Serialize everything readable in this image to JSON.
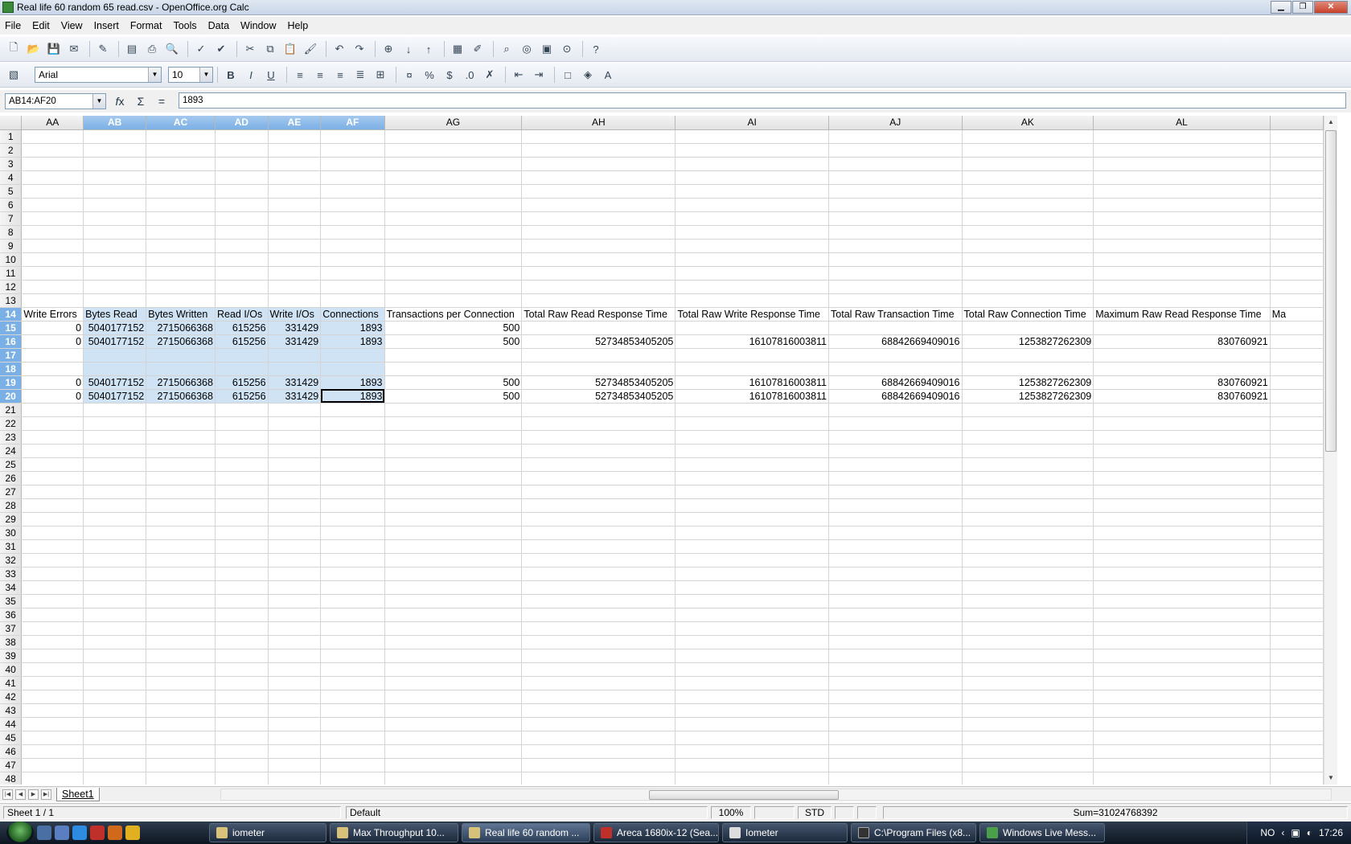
{
  "window": {
    "title": "Real life 60 random 65 read.csv - OpenOffice.org Calc"
  },
  "menu": [
    "File",
    "Edit",
    "View",
    "Insert",
    "Format",
    "Tools",
    "Data",
    "Window",
    "Help"
  ],
  "format_toolbar": {
    "font_name": "Arial",
    "font_size": "10"
  },
  "formula_bar": {
    "name_box": "AB14:AF20",
    "content": "1893"
  },
  "columns": [
    "AA",
    "AB",
    "AC",
    "AD",
    "AE",
    "AF",
    "AG",
    "AH",
    "AI",
    "AJ",
    "AK",
    "AL",
    ""
  ],
  "rows": [
    {
      "n": "1",
      "cells": [
        "",
        "",
        "",
        "",
        "",
        "",
        "",
        "",
        "",
        "",
        "",
        "",
        ""
      ]
    },
    {
      "n": "2",
      "cells": [
        "",
        "",
        "",
        "",
        "",
        "",
        "",
        "",
        "",
        "",
        "",
        "",
        ""
      ]
    },
    {
      "n": "3",
      "cells": [
        "",
        "",
        "",
        "",
        "",
        "",
        "",
        "",
        "",
        "",
        "",
        "",
        ""
      ]
    },
    {
      "n": "4",
      "cells": [
        "",
        "",
        "",
        "",
        "",
        "",
        "",
        "",
        "",
        "",
        "",
        "",
        ""
      ]
    },
    {
      "n": "5",
      "cells": [
        "",
        "",
        "",
        "",
        "",
        "",
        "",
        "",
        "",
        "",
        "",
        "",
        ""
      ]
    },
    {
      "n": "6",
      "cells": [
        "",
        "",
        "",
        "",
        "",
        "",
        "",
        "",
        "",
        "",
        "",
        "",
        ""
      ]
    },
    {
      "n": "7",
      "cells": [
        "",
        "",
        "",
        "",
        "",
        "",
        "",
        "",
        "",
        "",
        "",
        "",
        ""
      ]
    },
    {
      "n": "8",
      "cells": [
        "",
        "",
        "",
        "",
        "",
        "",
        "",
        "",
        "",
        "",
        "",
        "",
        ""
      ]
    },
    {
      "n": "9",
      "cells": [
        "",
        "",
        "",
        "",
        "",
        "",
        "",
        "",
        "",
        "",
        "",
        "",
        ""
      ]
    },
    {
      "n": "10",
      "cells": [
        "",
        "",
        "",
        "",
        "",
        "",
        "",
        "",
        "",
        "",
        "",
        "",
        ""
      ]
    },
    {
      "n": "11",
      "cells": [
        "",
        "",
        "",
        "",
        "",
        "",
        "",
        "",
        "",
        "",
        "",
        "",
        ""
      ]
    },
    {
      "n": "12",
      "cells": [
        "",
        "",
        "",
        "",
        "",
        "",
        "",
        "",
        "",
        "",
        "",
        "",
        ""
      ]
    },
    {
      "n": "13",
      "cells": [
        "",
        "",
        "",
        "",
        "",
        "",
        "",
        "",
        "",
        "",
        "",
        "",
        ""
      ]
    },
    {
      "n": "14",
      "cells": [
        "Write Errors",
        "Bytes Read",
        "Bytes Written",
        "Read I/Os",
        "Write I/Os",
        "Connections",
        "Transactions per Connection",
        "Total Raw Read Response Time",
        "Total Raw Write Response Time",
        "Total Raw Transaction Time",
        "Total Raw Connection Time",
        "Maximum Raw Read Response Time",
        "Ma"
      ]
    },
    {
      "n": "15",
      "cells": [
        "0",
        "5040177152",
        "2715066368",
        "615256",
        "331429",
        "1893",
        "500",
        "",
        "",
        "",
        "",
        "",
        ""
      ]
    },
    {
      "n": "16",
      "cells": [
        "0",
        "5040177152",
        "2715066368",
        "615256",
        "331429",
        "1893",
        "500",
        "52734853405205",
        "16107816003811",
        "68842669409016",
        "1253827262309",
        "830760921",
        ""
      ]
    },
    {
      "n": "17",
      "cells": [
        "",
        "",
        "",
        "",
        "",
        "",
        "",
        "",
        "",
        "",
        "",
        "",
        ""
      ]
    },
    {
      "n": "18",
      "cells": [
        "",
        "",
        "",
        "",
        "",
        "",
        "",
        "",
        "",
        "",
        "",
        "",
        ""
      ]
    },
    {
      "n": "19",
      "cells": [
        "0",
        "5040177152",
        "2715066368",
        "615256",
        "331429",
        "1893",
        "500",
        "52734853405205",
        "16107816003811",
        "68842669409016",
        "1253827262309",
        "830760921",
        ""
      ]
    },
    {
      "n": "20",
      "cells": [
        "0",
        "5040177152",
        "2715066368",
        "615256",
        "331429",
        "1893",
        "500",
        "52734853405205",
        "16107816003811",
        "68842669409016",
        "1253827262309",
        "830760921",
        ""
      ]
    },
    {
      "n": "21",
      "cells": [
        "",
        "",
        "",
        "",
        "",
        "",
        "",
        "",
        "",
        "",
        "",
        "",
        ""
      ]
    },
    {
      "n": "22",
      "cells": [
        "",
        "",
        "",
        "",
        "",
        "",
        "",
        "",
        "",
        "",
        "",
        "",
        ""
      ]
    },
    {
      "n": "23",
      "cells": [
        "",
        "",
        "",
        "",
        "",
        "",
        "",
        "",
        "",
        "",
        "",
        "",
        ""
      ]
    },
    {
      "n": "24",
      "cells": [
        "",
        "",
        "",
        "",
        "",
        "",
        "",
        "",
        "",
        "",
        "",
        "",
        ""
      ]
    },
    {
      "n": "25",
      "cells": [
        "",
        "",
        "",
        "",
        "",
        "",
        "",
        "",
        "",
        "",
        "",
        "",
        ""
      ]
    },
    {
      "n": "26",
      "cells": [
        "",
        "",
        "",
        "",
        "",
        "",
        "",
        "",
        "",
        "",
        "",
        "",
        ""
      ]
    },
    {
      "n": "27",
      "cells": [
        "",
        "",
        "",
        "",
        "",
        "",
        "",
        "",
        "",
        "",
        "",
        "",
        ""
      ]
    },
    {
      "n": "28",
      "cells": [
        "",
        "",
        "",
        "",
        "",
        "",
        "",
        "",
        "",
        "",
        "",
        "",
        ""
      ]
    },
    {
      "n": "29",
      "cells": [
        "",
        "",
        "",
        "",
        "",
        "",
        "",
        "",
        "",
        "",
        "",
        "",
        ""
      ]
    },
    {
      "n": "30",
      "cells": [
        "",
        "",
        "",
        "",
        "",
        "",
        "",
        "",
        "",
        "",
        "",
        "",
        ""
      ]
    },
    {
      "n": "31",
      "cells": [
        "",
        "",
        "",
        "",
        "",
        "",
        "",
        "",
        "",
        "",
        "",
        "",
        ""
      ]
    },
    {
      "n": "32",
      "cells": [
        "",
        "",
        "",
        "",
        "",
        "",
        "",
        "",
        "",
        "",
        "",
        "",
        ""
      ]
    },
    {
      "n": "33",
      "cells": [
        "",
        "",
        "",
        "",
        "",
        "",
        "",
        "",
        "",
        "",
        "",
        "",
        ""
      ]
    },
    {
      "n": "34",
      "cells": [
        "",
        "",
        "",
        "",
        "",
        "",
        "",
        "",
        "",
        "",
        "",
        "",
        ""
      ]
    },
    {
      "n": "35",
      "cells": [
        "",
        "",
        "",
        "",
        "",
        "",
        "",
        "",
        "",
        "",
        "",
        "",
        ""
      ]
    },
    {
      "n": "36",
      "cells": [
        "",
        "",
        "",
        "",
        "",
        "",
        "",
        "",
        "",
        "",
        "",
        "",
        ""
      ]
    },
    {
      "n": "37",
      "cells": [
        "",
        "",
        "",
        "",
        "",
        "",
        "",
        "",
        "",
        "",
        "",
        "",
        ""
      ]
    },
    {
      "n": "38",
      "cells": [
        "",
        "",
        "",
        "",
        "",
        "",
        "",
        "",
        "",
        "",
        "",
        "",
        ""
      ]
    },
    {
      "n": "39",
      "cells": [
        "",
        "",
        "",
        "",
        "",
        "",
        "",
        "",
        "",
        "",
        "",
        "",
        ""
      ]
    },
    {
      "n": "40",
      "cells": [
        "",
        "",
        "",
        "",
        "",
        "",
        "",
        "",
        "",
        "",
        "",
        "",
        ""
      ]
    },
    {
      "n": "41",
      "cells": [
        "",
        "",
        "",
        "",
        "",
        "",
        "",
        "",
        "",
        "",
        "",
        "",
        ""
      ]
    },
    {
      "n": "42",
      "cells": [
        "",
        "",
        "",
        "",
        "",
        "",
        "",
        "",
        "",
        "",
        "",
        "",
        ""
      ]
    },
    {
      "n": "43",
      "cells": [
        "",
        "",
        "",
        "",
        "",
        "",
        "",
        "",
        "",
        "",
        "",
        "",
        ""
      ]
    },
    {
      "n": "44",
      "cells": [
        "",
        "",
        "",
        "",
        "",
        "",
        "",
        "",
        "",
        "",
        "",
        "",
        ""
      ]
    },
    {
      "n": "45",
      "cells": [
        "",
        "",
        "",
        "",
        "",
        "",
        "",
        "",
        "",
        "",
        "",
        "",
        ""
      ]
    },
    {
      "n": "46",
      "cells": [
        "",
        "",
        "",
        "",
        "",
        "",
        "",
        "",
        "",
        "",
        "",
        "",
        ""
      ]
    },
    {
      "n": "47",
      "cells": [
        "",
        "",
        "",
        "",
        "",
        "",
        "",
        "",
        "",
        "",
        "",
        "",
        ""
      ]
    },
    {
      "n": "48",
      "cells": [
        "",
        "",
        "",
        "",
        "",
        "",
        "",
        "",
        "",
        "",
        "",
        "",
        ""
      ]
    }
  ],
  "sheet_tab": "Sheet1",
  "status": {
    "sheet": "Sheet 1 / 1",
    "style": "Default",
    "zoom": "100%",
    "mode": "STD",
    "sum": "Sum=31024768392"
  },
  "taskbar": {
    "buttons": [
      "iometer",
      "Max Throughput 10...",
      "Real life 60 random ...",
      "Areca 1680ix-12 (Sea...",
      "Iometer",
      "C:\\Program Files (x8...",
      "Windows Live Mess..."
    ],
    "lang": "NO",
    "clock": "17:26"
  },
  "colors": {
    "selection": "#cfe3f5",
    "header_selected": "#7bb0e6"
  }
}
